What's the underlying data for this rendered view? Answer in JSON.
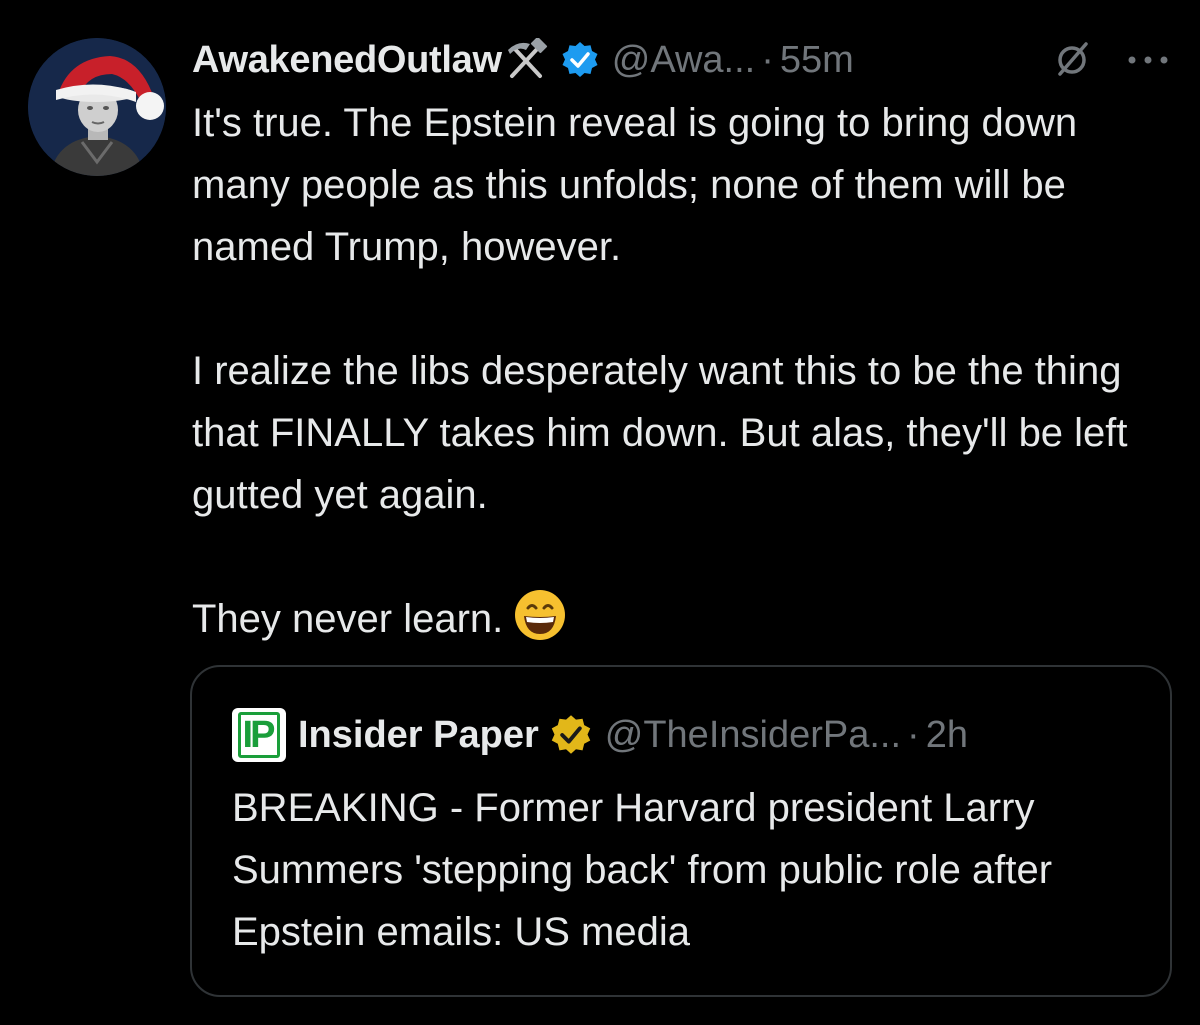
{
  "post": {
    "author": {
      "display_name": "AwakenedOutlaw",
      "name_emoji": "hammer-and-pick",
      "verified_color": "#1d9bf0",
      "handle": "@Awa...",
      "separator": "·",
      "timestamp": "55m"
    },
    "icons": {
      "grok": "grok-icon",
      "more": "more-icon"
    },
    "body_paragraphs": [
      "It's true. The Epstein reveal is going to bring down many people as this unfolds; none of them will be named Trump, however.",
      "I realize the libs desperately want this to be the thing that FINALLY takes him down.  But alas, they'll be left gutted yet again.",
      "They never learn."
    ],
    "body_emoji": "grinning-face-with-smiling-eyes"
  },
  "quoted_post": {
    "logo_text": "IP",
    "display_name": "Insider Paper",
    "verified_color": "#e2b719",
    "handle": "@TheInsiderPa...",
    "separator": "·",
    "timestamp": "2h",
    "text": "BREAKING - Former Harvard president Larry Summers 'stepping back' from public role after Epstein emails: US media"
  },
  "colors": {
    "background": "#000000",
    "text_primary": "#e7e9ea",
    "text_secondary": "#71767b",
    "border": "#2f3336"
  }
}
